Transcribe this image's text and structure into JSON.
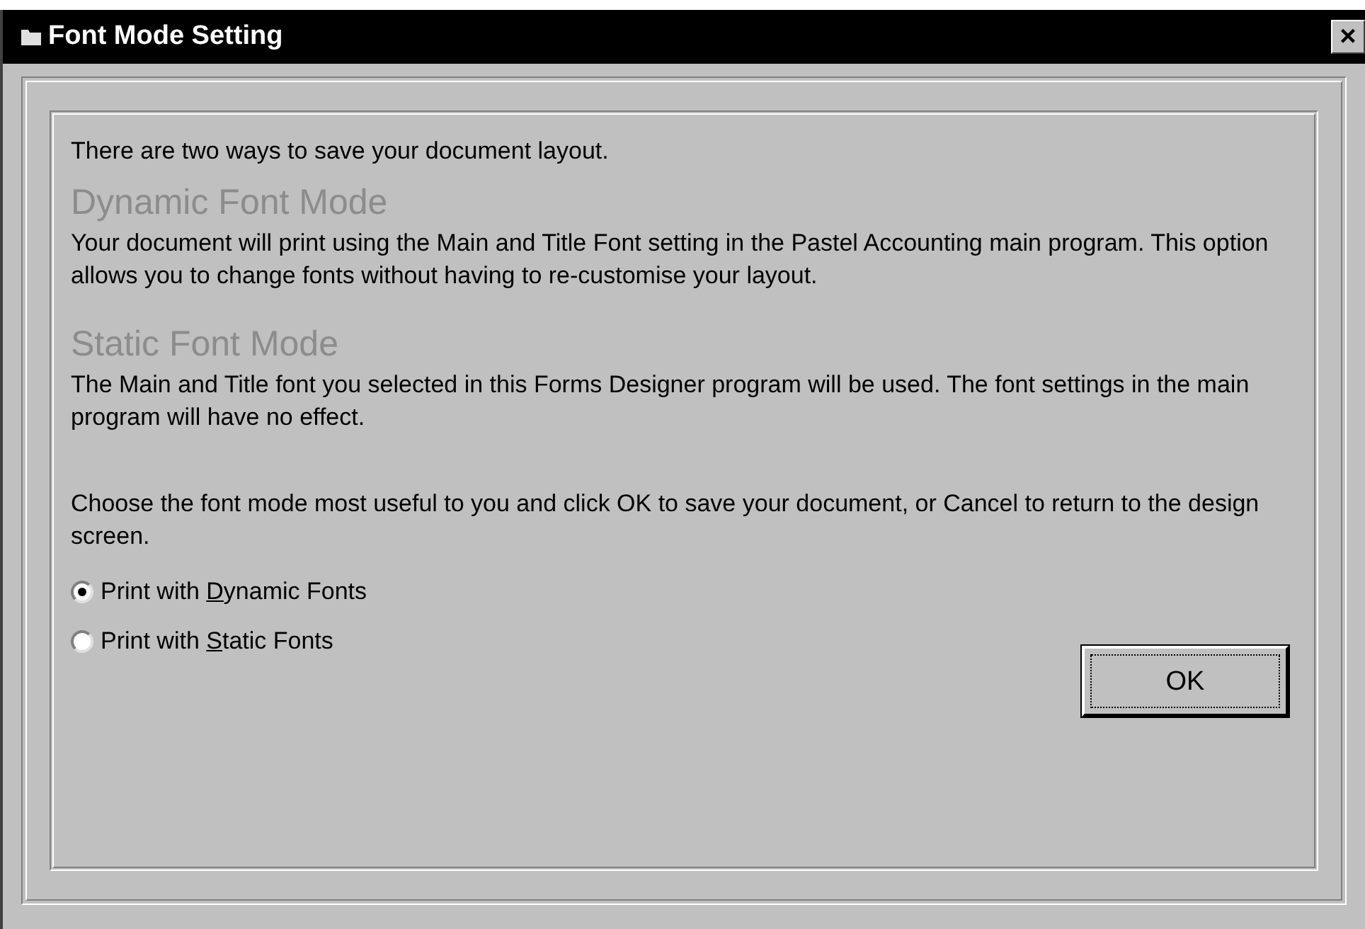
{
  "window": {
    "title": "Font Mode Setting",
    "close_label": "×"
  },
  "intro": "There are two ways to save your document layout.",
  "modes": [
    {
      "heading": "Dynamic Font Mode",
      "text": "Your document will print using the Main and Title Font setting in the Pastel Accounting main program. This option allows you to change fonts without having to re-customise your layout."
    },
    {
      "heading": "Static Font Mode",
      "text": "The Main and Title font you selected in this Forms Designer program will be used. The font settings in the main program will have no effect."
    }
  ],
  "instruction": "Choose the font mode most useful to you and click OK to save your document, or Cancel to return to the design screen.",
  "options": [
    {
      "label_before": "Print with ",
      "accel": "D",
      "label_after": "ynamic Fonts",
      "selected": true
    },
    {
      "label_before": "Print with ",
      "accel": "S",
      "label_after": "tatic Fonts",
      "selected": false
    }
  ],
  "ok_button": "OK"
}
